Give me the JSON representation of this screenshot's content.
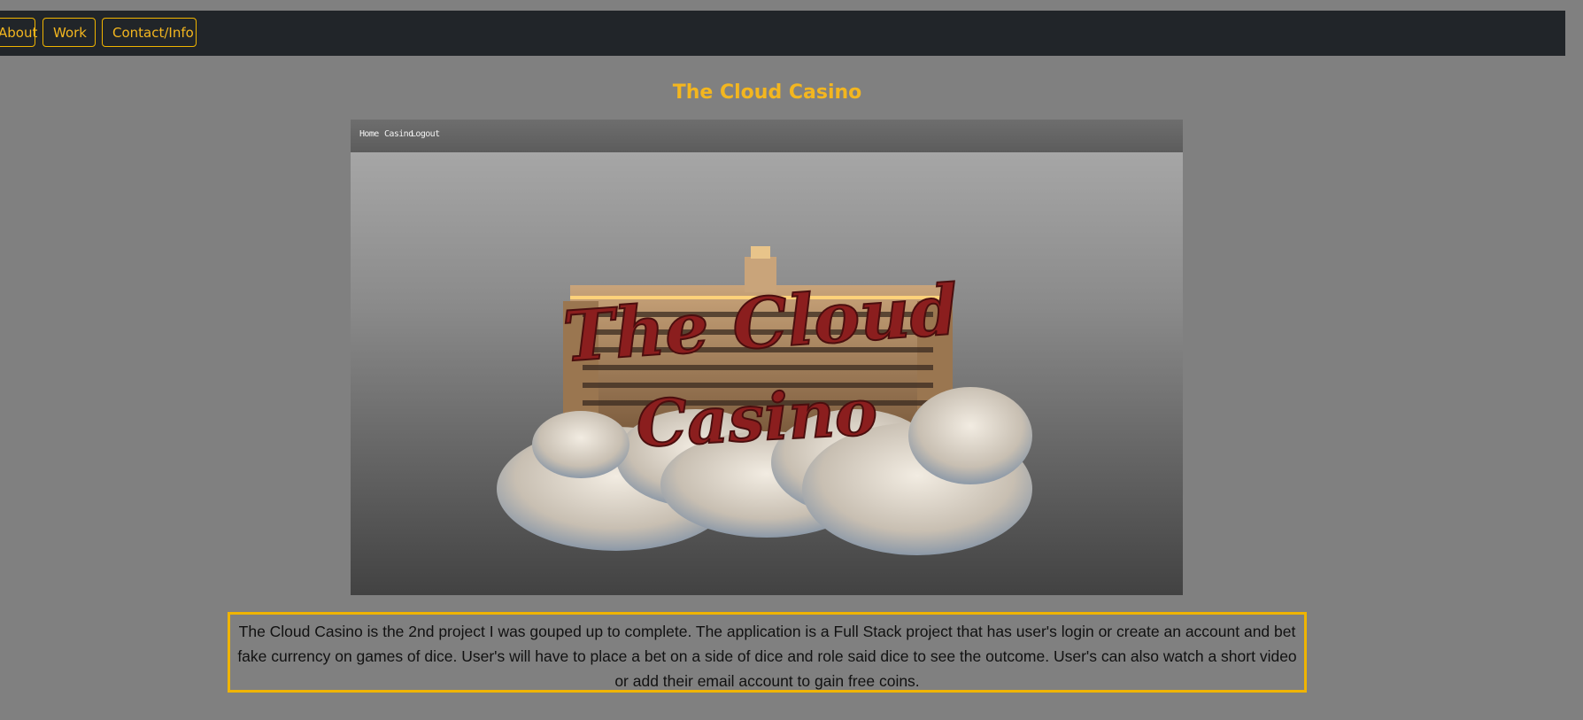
{
  "nav": {
    "about": "About",
    "work": "Work",
    "contact": "Contact/Info"
  },
  "project": {
    "title": "The Cloud Casino",
    "screenshot_nav": [
      "Home",
      "Casino",
      "Logout"
    ],
    "logo_line1": "The Cloud",
    "logo_line2": "Casino",
    "description": "The Cloud Casino is the 2nd project I was gouped up to complete. The application is a Full Stack project that has user's login or create an account and bet fake currency on games of dice. User's will have to place a bet on a side of dice and role said dice to see the outcome. User's can also watch a short video or add their email account to gain free coins."
  },
  "colors": {
    "accent": "#f3b61f",
    "navbar": "#212529",
    "page_bg": "#808080",
    "logo_text": "#8b1e1e"
  }
}
